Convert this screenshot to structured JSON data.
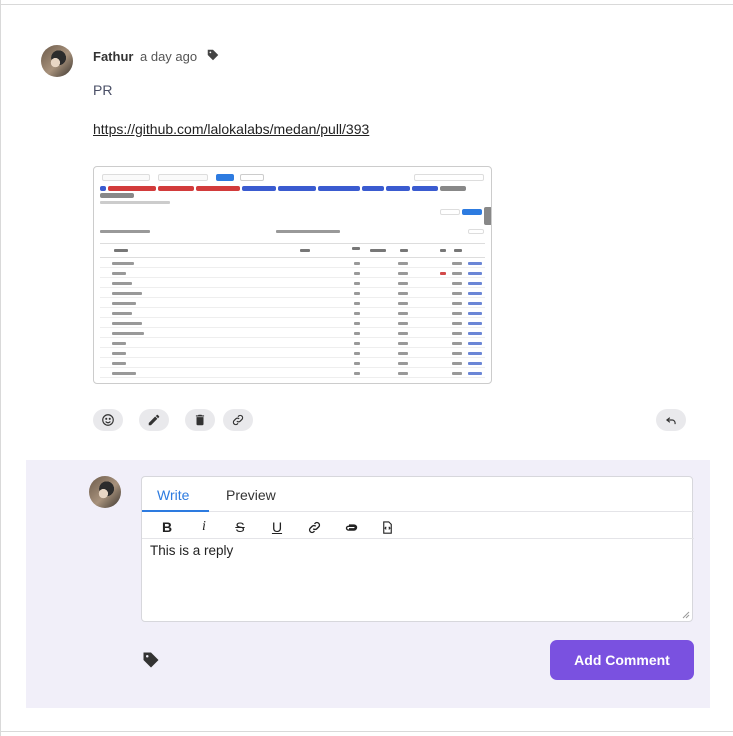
{
  "comment": {
    "author": "Fathur",
    "timestamp": "a day ago",
    "body": "PR",
    "link": "https://github.com/lalokalabs/medan/pull/393",
    "actions": [
      "emoji-icon",
      "edit-icon",
      "trash-icon",
      "link-icon",
      "reply-icon"
    ]
  },
  "reply": {
    "tabs": {
      "write": "Write",
      "preview": "Preview"
    },
    "toolbar": {
      "bold": "B",
      "italic": "i",
      "strike": "S",
      "underline": "U"
    },
    "input_value": "This is a reply",
    "submit_label": "Add Comment"
  },
  "colors": {
    "accent": "#7a51e0",
    "tab_active": "#2d7be0",
    "reply_panel_bg": "#f1eff9"
  }
}
